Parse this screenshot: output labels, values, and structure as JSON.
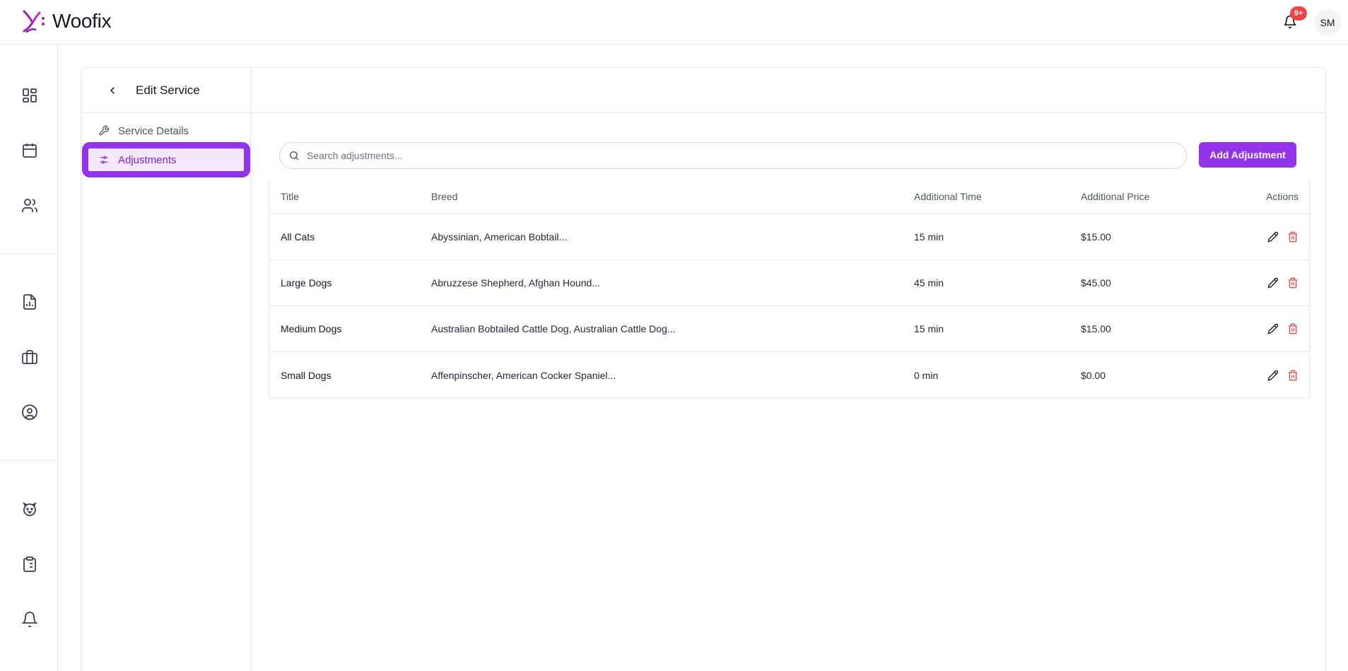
{
  "brand": {
    "name": "Woofix",
    "accent": "#9333ea",
    "danger": "#ef4444"
  },
  "topbar": {
    "notification_badge": "9+",
    "avatar_initials": "SM"
  },
  "rail": {
    "items": [
      {
        "icon": "dashboard-icon"
      },
      {
        "icon": "calendar-icon"
      },
      {
        "icon": "users-icon"
      },
      {
        "icon": "report-icon"
      },
      {
        "icon": "briefcase-icon"
      },
      {
        "icon": "user-circle-icon"
      },
      {
        "icon": "dog-icon"
      },
      {
        "icon": "clipboard-list-icon"
      },
      {
        "icon": "bell-icon"
      }
    ]
  },
  "page": {
    "title": "Edit Service"
  },
  "side_nav": {
    "items": [
      {
        "label": "Service Details",
        "icon": "wrench-icon",
        "active": false
      },
      {
        "label": "Adjustments",
        "icon": "sliders-icon",
        "active": true
      }
    ]
  },
  "search": {
    "placeholder": "Search adjustments...",
    "value": ""
  },
  "add_button": {
    "label": "Add Adjustment"
  },
  "table": {
    "headers": {
      "title": "Title",
      "breed": "Breed",
      "time": "Additional Time",
      "price": "Additional Price",
      "actions": "Actions"
    },
    "rows": [
      {
        "title": "All Cats",
        "breed": "Abyssinian, American Bobtail...",
        "time": "15 min",
        "price": "$15.00"
      },
      {
        "title": "Large Dogs",
        "breed": "Abruzzese Shepherd, Afghan Hound...",
        "time": "45 min",
        "price": "$45.00"
      },
      {
        "title": "Medium Dogs",
        "breed": "Australian Bobtailed Cattle Dog, Australian Cattle Dog...",
        "time": "15 min",
        "price": "$15.00"
      },
      {
        "title": "Small Dogs",
        "breed": "Affenpinscher, American Cocker Spaniel...",
        "time": "0 min",
        "price": "$0.00"
      }
    ]
  }
}
